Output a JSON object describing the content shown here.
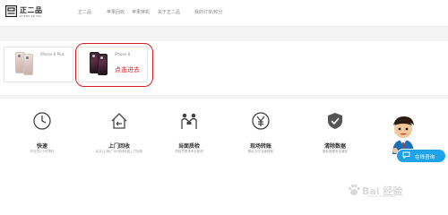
{
  "header": {
    "logo": {
      "title": "正二品",
      "subtitle": "ZHENG ER PIN"
    },
    "nav": [
      "正二品",
      "苹果回收",
      "苹果换机",
      "关于正二品",
      "我的订单/积分"
    ]
  },
  "products": [
    {
      "name": "iPhone 8 Plus",
      "color": "gold"
    },
    {
      "name": "iPhone 8",
      "color": "dark"
    }
  ],
  "annotation": {
    "text": "点击进去",
    "color": "#d42020"
  },
  "features": [
    {
      "icon": "clock-icon",
      "title": "快速",
      "desc": "作业员2小时预约"
    },
    {
      "icon": "home-return-icon",
      "title": "上门回收",
      "desc": "北京/上海/广州/深圳免费上门回收"
    },
    {
      "icon": "handshake-icon",
      "title": "当面质检",
      "desc": "质检员现场专业检测"
    },
    {
      "icon": "yen-icon",
      "title": "现场转账",
      "desc": "确认交付当面转账"
    },
    {
      "icon": "shield-icon",
      "title": "清除数据",
      "desc": "隐私数据安全清除"
    }
  ],
  "service": {
    "label": "在线咨询",
    "color": "#1ea2e8"
  },
  "watermark": {
    "text": "Bai 经验",
    "sub": "jingyan.baidu.com"
  }
}
